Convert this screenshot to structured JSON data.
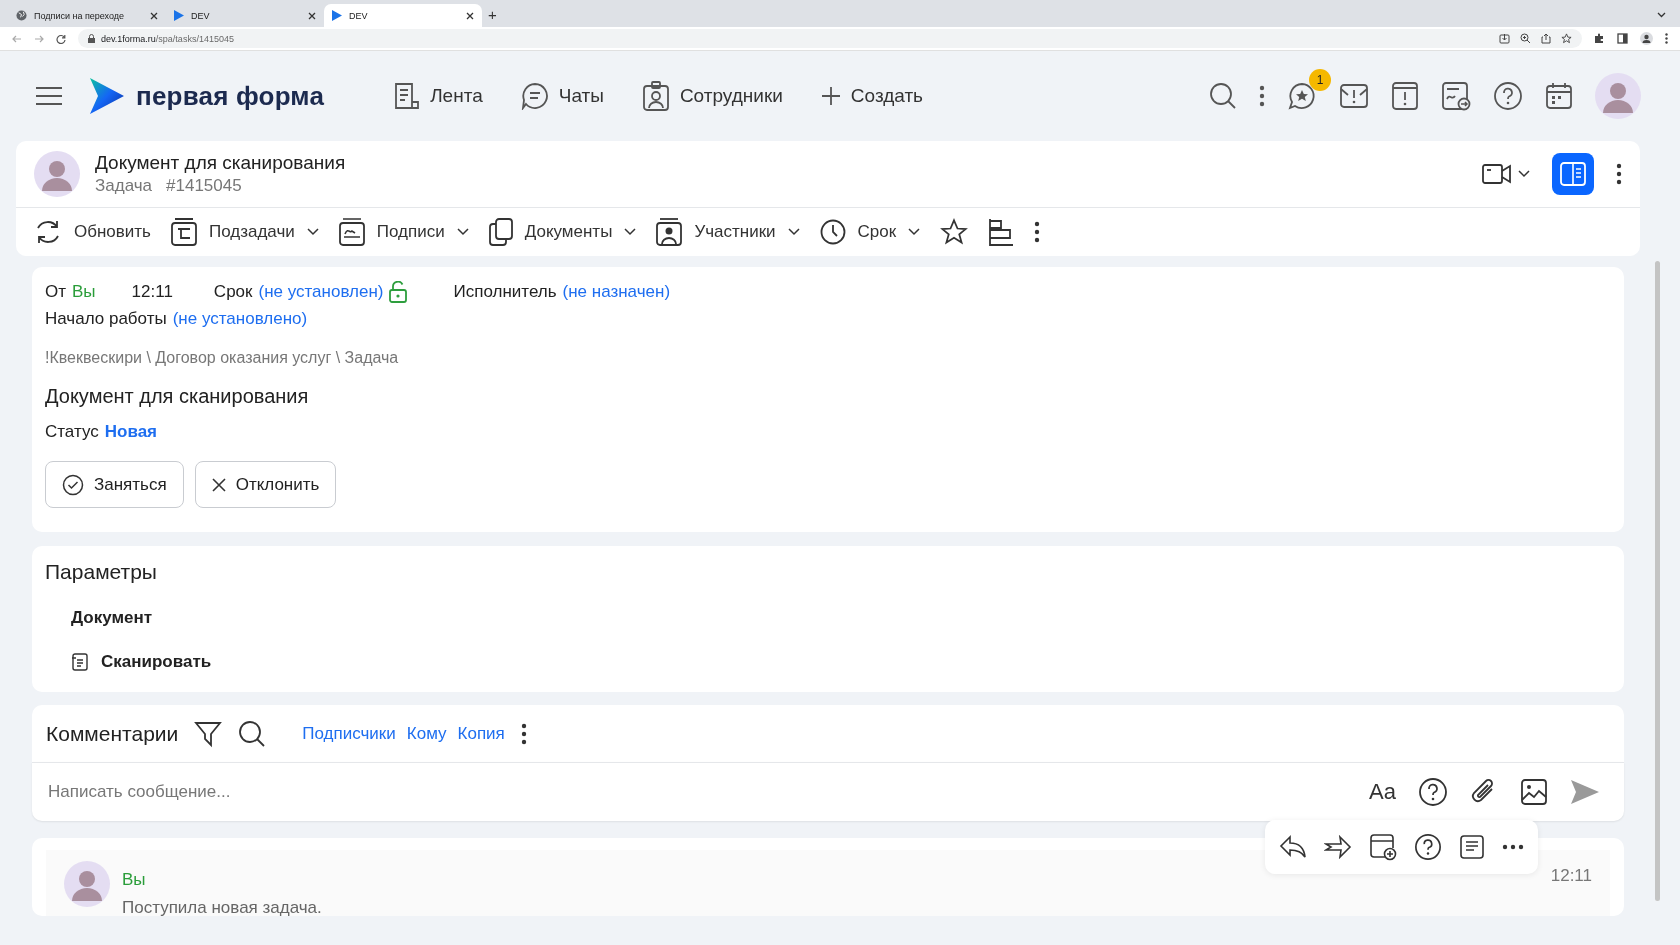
{
  "browser": {
    "tabs": [
      {
        "title": "Подписи на переходе",
        "selected": false
      },
      {
        "title": "DEV",
        "selected": false
      },
      {
        "title": "DEV",
        "selected": true
      }
    ],
    "new_tab": "+",
    "url_host": "dev.1forma.ru",
    "url_path": "/spa/tasks/1415045"
  },
  "header": {
    "logo": "первая форма",
    "nav": [
      "Лента",
      "Чаты",
      "Сотрудники",
      "Создать"
    ],
    "badge": "1"
  },
  "task": {
    "title": "Документ для сканирования",
    "type": "Задача",
    "number": "#1415045",
    "panel_toggle": {
      "on": true
    }
  },
  "toolbar": [
    {
      "label": "Обновить",
      "kind": "button"
    },
    {
      "label": "Подзадачи",
      "kind": "dropdown"
    },
    {
      "label": "Подписи",
      "kind": "dropdown"
    },
    {
      "label": "Документы",
      "kind": "dropdown"
    },
    {
      "label": "Участники",
      "kind": "dropdown"
    },
    {
      "label": "Срок",
      "kind": "dropdown"
    }
  ],
  "details": {
    "from_label": "От",
    "from": "Вы",
    "time": "12:11",
    "deadline_label": "Срок",
    "deadline": "(не установлен)",
    "deadline_locked": false,
    "assignee_label": "Исполнитель",
    "assignee": "(не назначен)",
    "start_label": "Начало работы",
    "start": "(не установлено)",
    "path": "!Квеквескири \\ Договор оказания услуг \\ Задача",
    "heading": "Документ для сканирования",
    "status_label": "Статус",
    "status": "Новая",
    "actions": [
      "Заняться",
      "Отклонить"
    ]
  },
  "parameters": {
    "title": "Параметры",
    "field_label": "Документ",
    "action": "Сканировать"
  },
  "comments": {
    "title": "Комментарии",
    "links": [
      "Подписчики",
      "Кому",
      "Копия"
    ],
    "placeholder": "Написать сообщение...",
    "format_label": "Aa"
  },
  "messages": [
    {
      "author": "Вы",
      "text": "Поступила новая задача.",
      "time": "12:11"
    }
  ]
}
